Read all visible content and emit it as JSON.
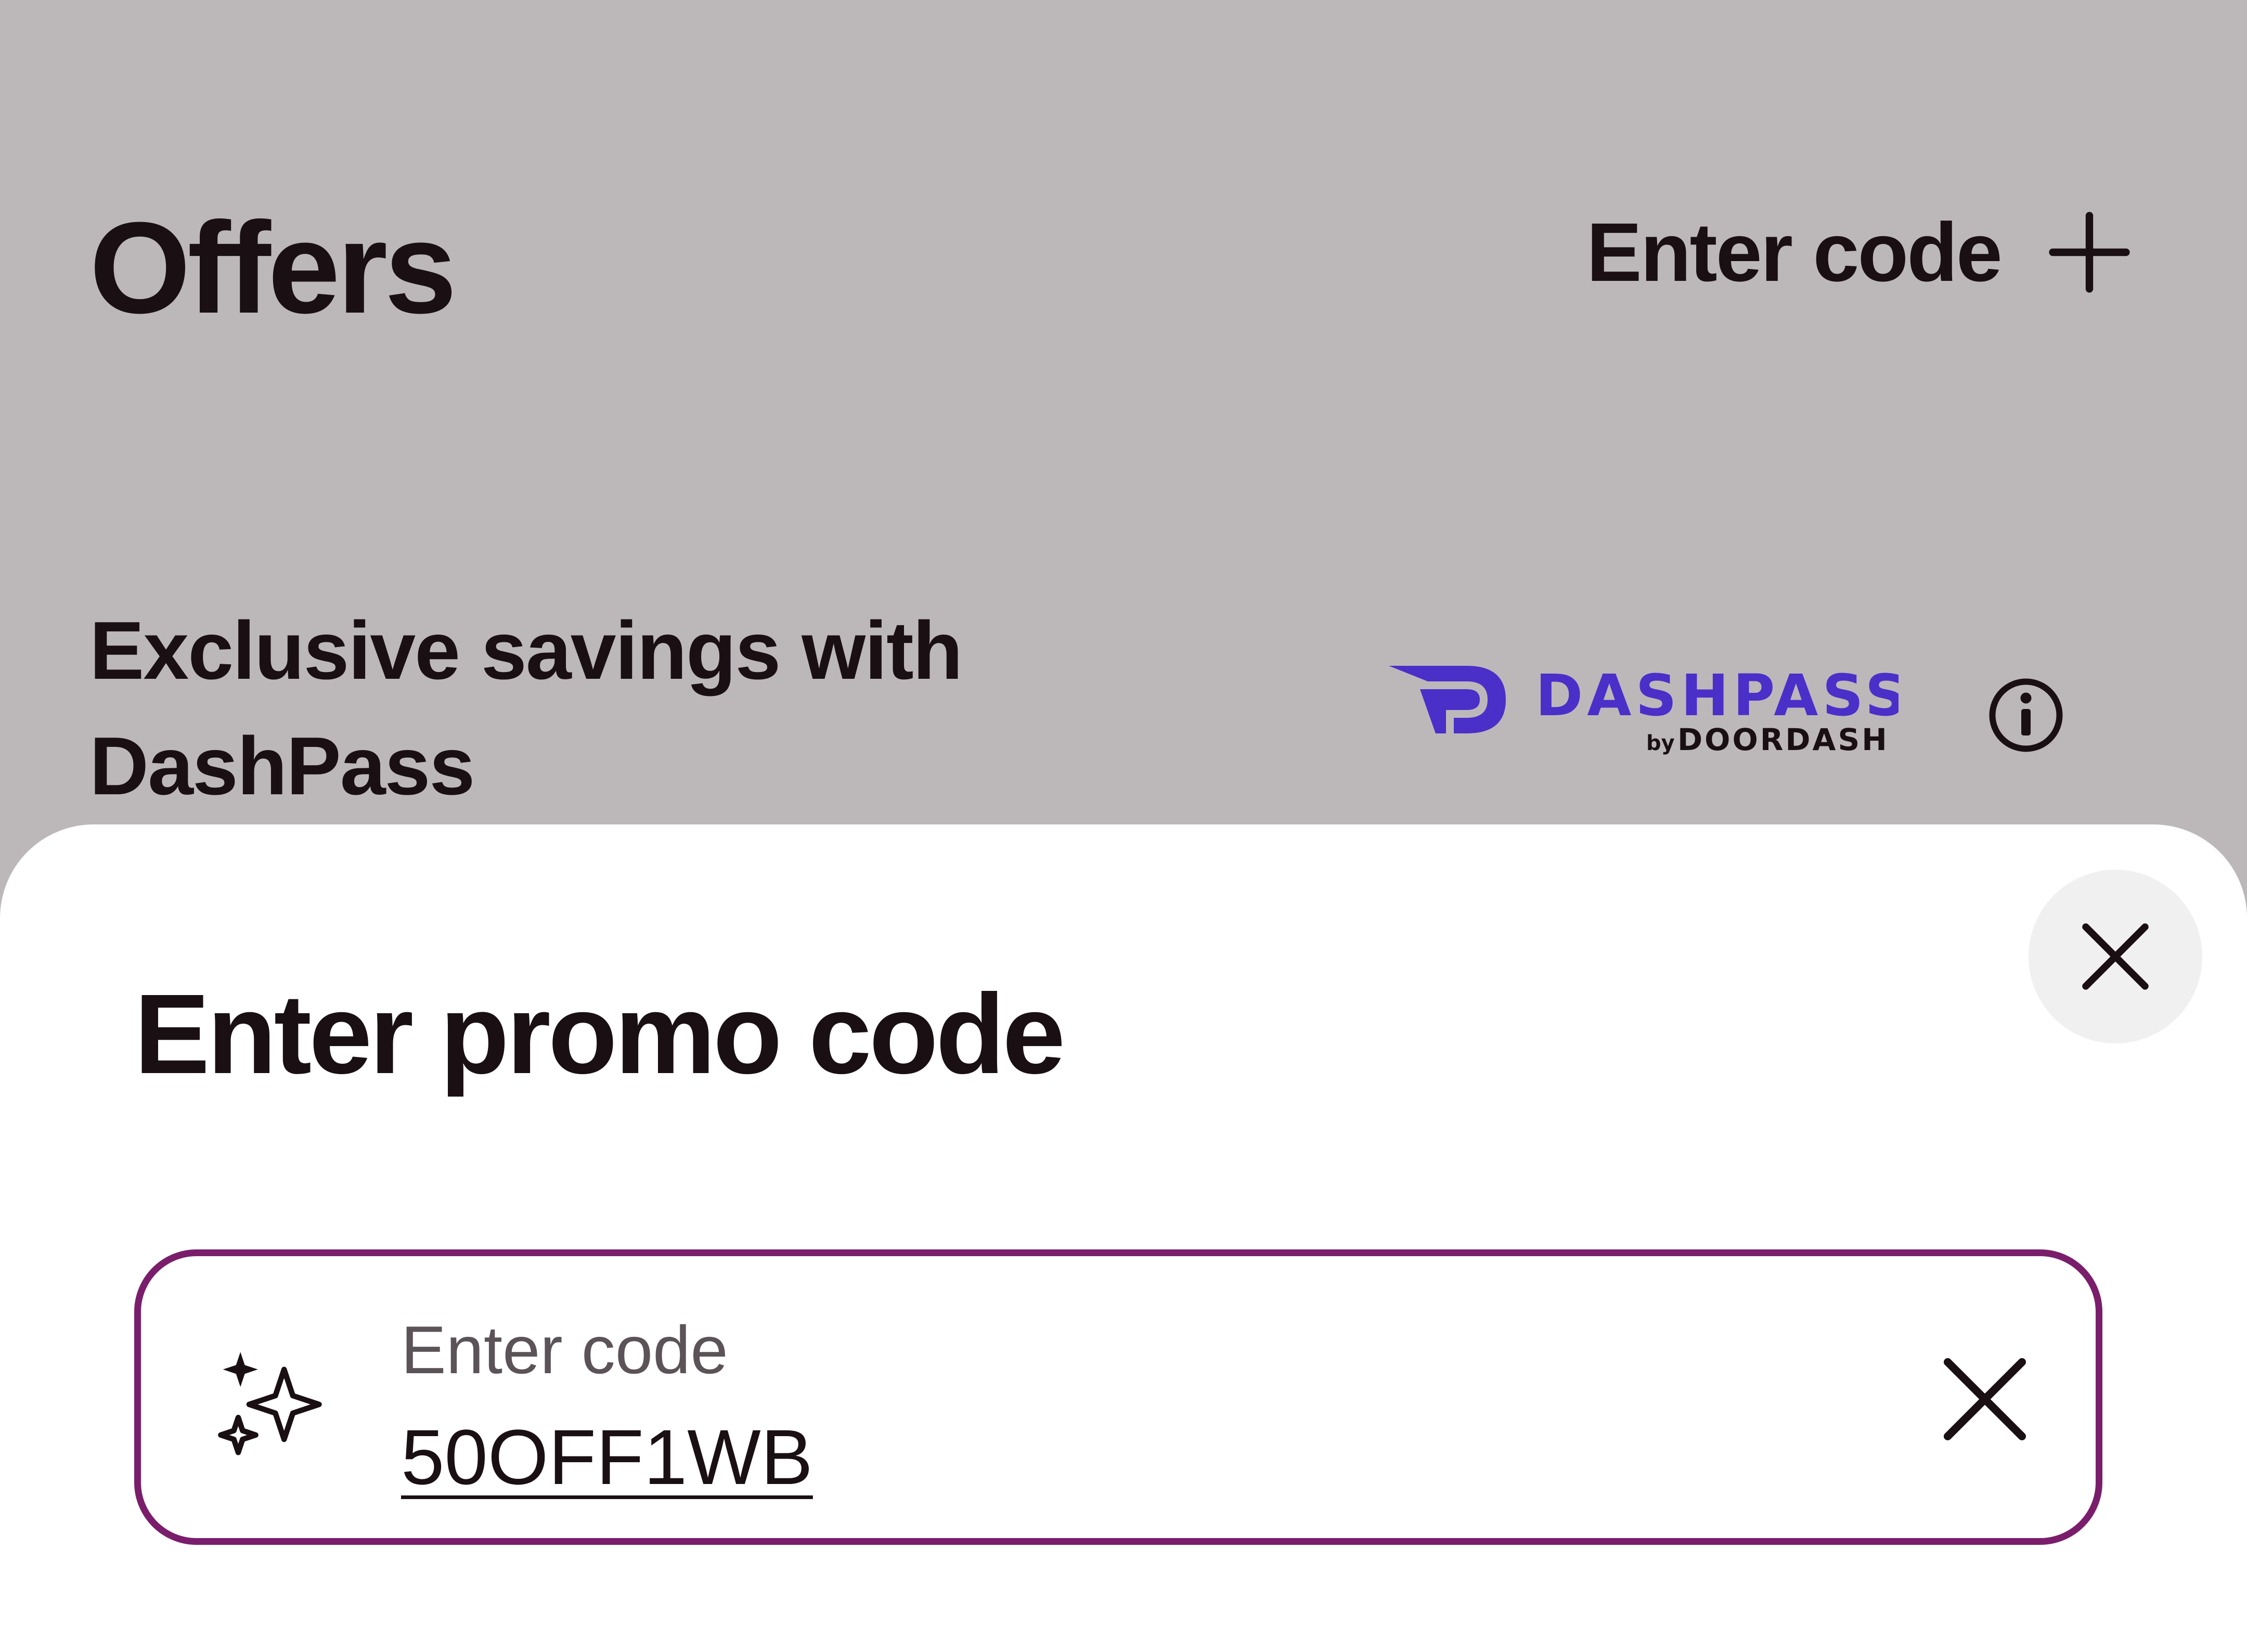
{
  "background_page": {
    "title": "Offers",
    "enter_code_label": "Enter code",
    "dashpass_heading": "Exclusive savings with DashPass",
    "dashpass_logo": {
      "brand": "DASHPASS",
      "by": "by",
      "company": "DOORDASH",
      "color": "#4b2fc9"
    }
  },
  "sheet": {
    "title": "Enter promo code",
    "field": {
      "label": "Enter code",
      "value": "50OFF1WB",
      "border_color": "#7a1e6c"
    }
  },
  "icons": {
    "plus": "plus-icon",
    "info": "info-icon",
    "close": "close-icon",
    "sparkle": "sparkle-icon",
    "clear": "clear-icon"
  }
}
